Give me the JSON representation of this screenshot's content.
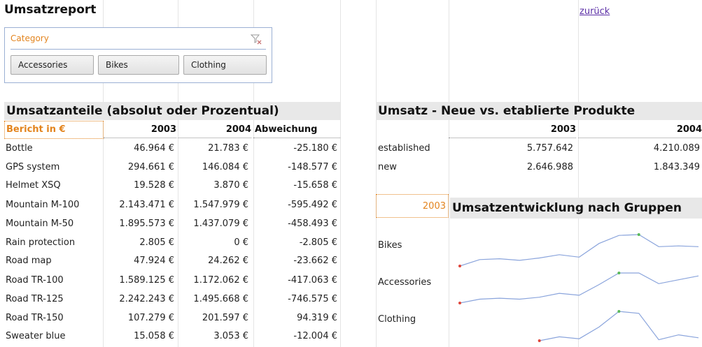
{
  "title": "Umsatzreport",
  "back_link": "zurück",
  "slicer": {
    "header": "Category",
    "icon": "clear-filter-icon",
    "buttons": [
      "Accessories",
      "Bikes",
      "Clothing"
    ]
  },
  "left_table": {
    "header": "Umsatzanteile (absolut oder Prozentual)",
    "filter_label": "Bericht in €",
    "columns": [
      "2003",
      "2004",
      "Abweichung"
    ],
    "rows": [
      {
        "name": "Bottle",
        "v2003": "46.964 €",
        "v2004": "21.783 €",
        "diff": "-25.180 €"
      },
      {
        "name": "GPS system",
        "v2003": "294.661 €",
        "v2004": "146.084 €",
        "diff": "-148.577 €"
      },
      {
        "name": "Helmet XSQ",
        "v2003": "19.528 €",
        "v2004": "3.870 €",
        "diff": "-15.658 €"
      },
      {
        "name": "Mountain M-100",
        "v2003": "2.143.471 €",
        "v2004": "1.547.979 €",
        "diff": "-595.492 €"
      },
      {
        "name": "Mountain M-50",
        "v2003": "1.895.573 €",
        "v2004": "1.437.079 €",
        "diff": "-458.493 €"
      },
      {
        "name": "Rain protection",
        "v2003": "2.805 €",
        "v2004": "0 €",
        "diff": "-2.805 €"
      },
      {
        "name": "Road map",
        "v2003": "47.924 €",
        "v2004": "24.262 €",
        "diff": "-23.662 €"
      },
      {
        "name": "Road TR-100",
        "v2003": "1.589.125 €",
        "v2004": "1.172.062 €",
        "diff": "-417.063 €"
      },
      {
        "name": "Road TR-125",
        "v2003": "2.242.243 €",
        "v2004": "1.495.668 €",
        "diff": "-746.575 €"
      },
      {
        "name": "Road TR-150",
        "v2003": "107.279 €",
        "v2004": "201.597 €",
        "diff": "94.319 €"
      },
      {
        "name": "Sweater blue",
        "v2003": "15.058 €",
        "v2004": "3.053 €",
        "diff": "-12.004 €"
      }
    ]
  },
  "right_table": {
    "header": "Umsatz - Neue vs. etablierte Produkte",
    "columns": [
      "2003",
      "2004"
    ],
    "rows": [
      {
        "name": "established",
        "v2003": "5.757.642",
        "v2004": "4.210.089"
      },
      {
        "name": "new",
        "v2003": "2.646.988",
        "v2004": "1.843.349"
      }
    ]
  },
  "sparklines": {
    "year": "2003",
    "header": "Umsatzentwicklung nach Gruppen",
    "line_color": "#8aa4dc",
    "low_color": "#e0453a",
    "high_color": "#58b858",
    "groups": [
      {
        "label": "Bikes",
        "values": [
          10,
          18,
          19,
          17,
          20,
          24,
          21,
          38,
          48,
          49,
          34,
          35,
          34
        ]
      },
      {
        "label": "Accessories",
        "values": [
          10,
          14,
          15,
          14,
          16,
          20,
          18,
          29,
          41,
          41,
          30,
          34,
          38
        ]
      },
      {
        "label": "Clothing",
        "values": [
          null,
          null,
          null,
          null,
          14,
          18,
          16,
          28,
          44,
          42,
          15,
          20,
          17
        ]
      }
    ]
  }
}
